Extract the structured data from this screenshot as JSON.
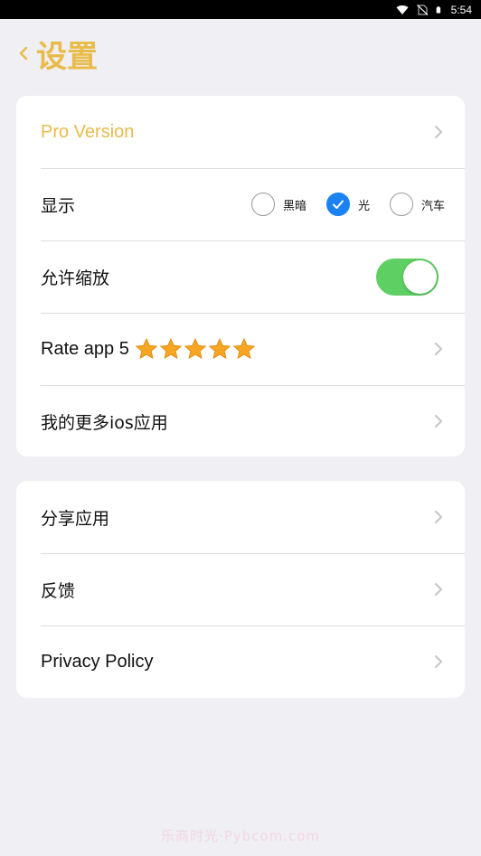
{
  "status_bar": {
    "time": "5:54",
    "icons": [
      "wifi-icon",
      "no-sim-icon",
      "battery-icon"
    ]
  },
  "header": {
    "title": "设置",
    "back_icon": "chevron-left-icon"
  },
  "settings_group_1": {
    "pro_version": {
      "label": "Pro Version"
    },
    "display": {
      "label": "显示",
      "options": [
        {
          "label": "黑暗",
          "checked": false
        },
        {
          "label": "光",
          "checked": true
        },
        {
          "label": "汽车",
          "checked": false
        }
      ]
    },
    "allow_zoom": {
      "label": "允许缩放",
      "enabled": true
    },
    "rate_app": {
      "label": "Rate app 5",
      "stars": 5
    },
    "more_apps": {
      "label": "我的更多ios应用"
    }
  },
  "settings_group_2": {
    "share_app": {
      "label": "分享应用"
    },
    "feedback": {
      "label": "反馈"
    },
    "privacy_policy": {
      "label": "Privacy Policy"
    }
  },
  "colors": {
    "accent": "#e9bb49",
    "background": "#efeff4",
    "radio_checked": "#1a82f2",
    "toggle_on": "#5ecf62",
    "star": "#f6a623"
  },
  "watermark": {
    "text": "乐商时光·Pybcom.com"
  }
}
